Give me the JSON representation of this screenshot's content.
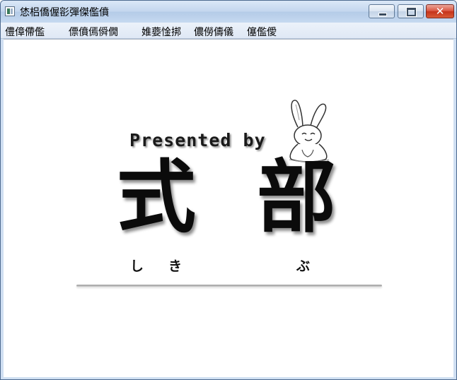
{
  "window": {
    "title": "恷梠僑偓彮彈傑儖僨",
    "icon": "app-window-icon"
  },
  "caption_buttons": {
    "minimize_icon": "minimize-icon",
    "maximize_icon": "maximize-icon",
    "close_icon": "close-icon",
    "close_glyph": "✕"
  },
  "menu": {
    "items": [
      {
        "label": "僼傽僀儖"
      },
      {
        "label": "僄僨傿僢僩"
      },
      {
        "label": "婎嬊惍挷"
      },
      {
        "label": "儂僗儔儀"
      },
      {
        "label": "僿儖僾"
      }
    ]
  },
  "splash": {
    "presented_by": "Presented by",
    "name_kanji": [
      "式",
      "部"
    ],
    "furigana": [
      "し",
      "き",
      "ぶ"
    ],
    "mascot_icon": "rabbit-icon"
  },
  "colors": {
    "title_bar": "#c6d9f0",
    "close_button": "#d9553f",
    "client_background": "#ffffff",
    "text": "#0b0b0b"
  }
}
